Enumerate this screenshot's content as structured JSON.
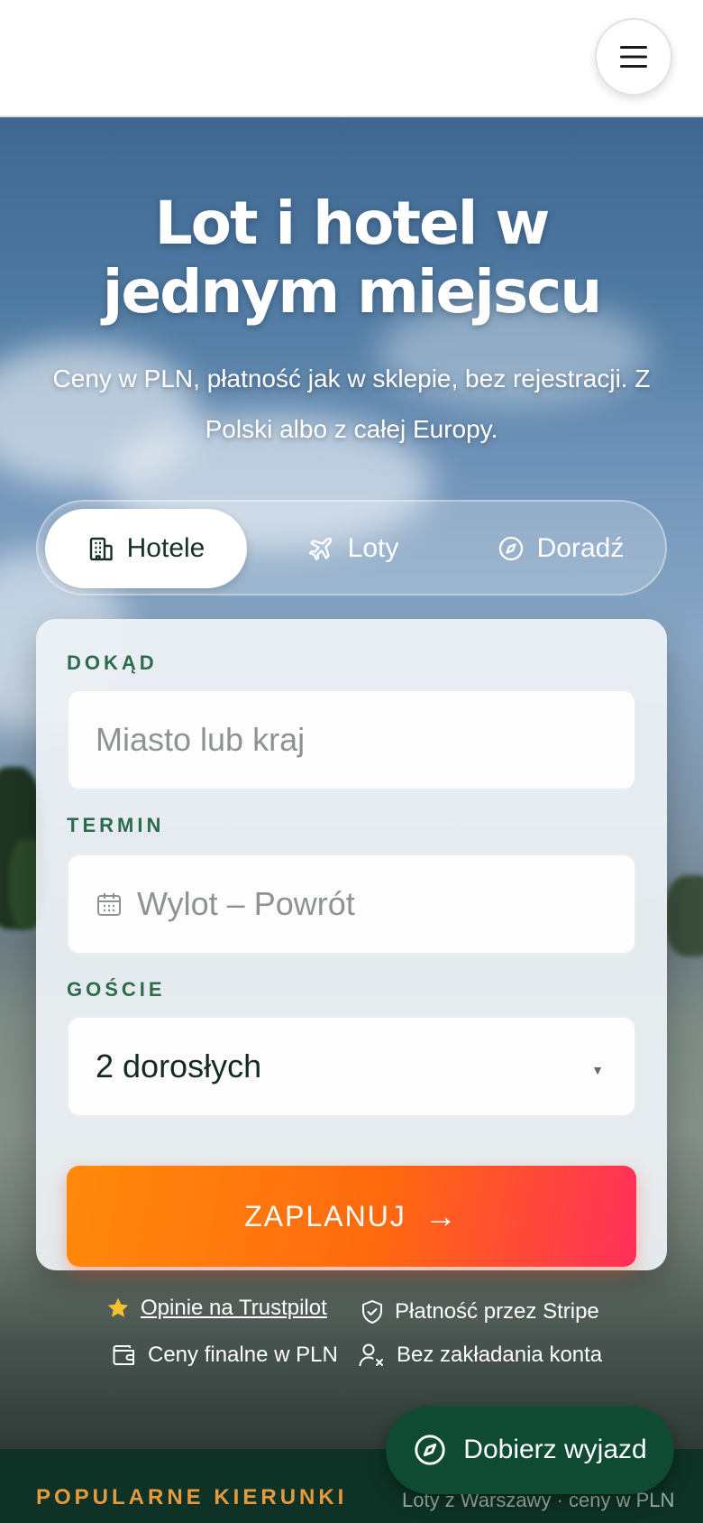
{
  "header": {
    "menu_icon": "hamburger-menu-icon"
  },
  "hero": {
    "title": "Lot i hotel w jednym miejscu",
    "subtitle": "Ceny w PLN, płatność jak w sklepie, bez rejestracji. Z Polski albo z całej Europy."
  },
  "tabs": [
    {
      "label": "Hotele",
      "icon": "building-icon",
      "active": true
    },
    {
      "label": "Loty",
      "icon": "plane-icon",
      "active": false
    },
    {
      "label": "Doradź",
      "icon": "compass-icon",
      "active": false
    }
  ],
  "form": {
    "destination": {
      "label": "DOKĄD",
      "placeholder": "Miasto lub kraj"
    },
    "dates": {
      "label": "TERMIN",
      "placeholder": "Wylot – Powrót",
      "icon": "calendar-icon"
    },
    "guests": {
      "label": "GOŚCIE",
      "value": "2 dorosłych",
      "icon": "caret-down-icon"
    },
    "submit": {
      "label": "ZAPLANUJ",
      "arrow": "→"
    }
  },
  "trust": [
    {
      "label": "Opinie na Trustpilot",
      "icon": "star-icon",
      "link": true
    },
    {
      "label": "Płatność przez Stripe",
      "icon": "shield-check-icon",
      "link": false
    },
    {
      "label": "Ceny finalne w PLN",
      "icon": "wallet-icon",
      "link": false
    },
    {
      "label": "Bez zakładania konta",
      "icon": "user-x-icon",
      "link": false
    }
  ],
  "popular": {
    "label": "POPULARNE KIERUNKI",
    "note": "Loty z Warszawy · ceny w PLN"
  },
  "fab": {
    "label": "Dobierz wyjazd",
    "icon": "compass-icon"
  },
  "colors": {
    "brand_green": "#0f4a33",
    "label_green": "#2c6b4c",
    "cta_orange": "#ff6a0e",
    "cta_pink": "#ff2f5a",
    "accent_gold": "#e79a3c"
  }
}
